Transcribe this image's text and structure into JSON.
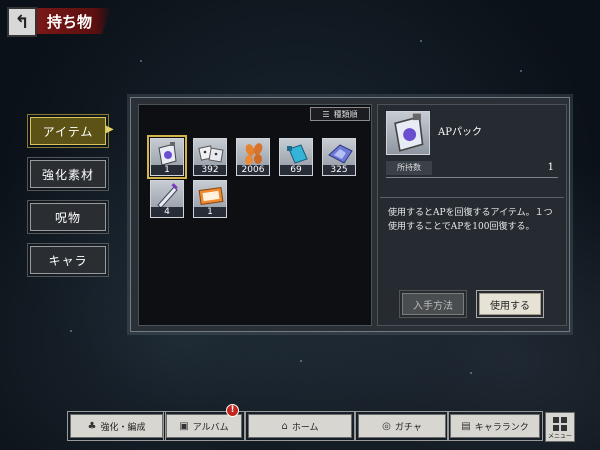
{
  "header": {
    "back_icon": "back-arrow-icon",
    "title": "持ち物"
  },
  "tabs": [
    {
      "label": "アイテム",
      "active": true
    },
    {
      "label": "強化素材",
      "active": false
    },
    {
      "label": "呪物",
      "active": false
    },
    {
      "label": "キャラ",
      "active": false
    }
  ],
  "sort_label": "種類順",
  "items": [
    {
      "name": "AP pack",
      "icon": "ap-pack-icon",
      "count": "1",
      "selected": true
    },
    {
      "name": "dice",
      "icon": "dice-icon",
      "count": "392"
    },
    {
      "name": "seeds",
      "icon": "seeds-icon",
      "count": "2006"
    },
    {
      "name": "bottle",
      "icon": "bottle-icon",
      "count": "69"
    },
    {
      "name": "crystal",
      "icon": "crystal-icon",
      "count": "325"
    },
    {
      "name": "sword",
      "icon": "sword-icon",
      "count": "4"
    },
    {
      "name": "ticket",
      "icon": "ticket-icon",
      "count": "1"
    }
  ],
  "detail": {
    "name": "APパック",
    "qty_label": "所持数",
    "qty_value": "1",
    "description": "使用するとAPを回復するアイテム。１つ使用することでAPを100回復する。",
    "source_button": "入手方法",
    "use_button": "使用する"
  },
  "nav": {
    "enhance": "強化・編成",
    "album": "アルバム",
    "album_badge": "!",
    "home": "ホーム",
    "gacha": "ガチャ",
    "character_rank": "キャラランク",
    "menu": "メニュー"
  },
  "colors": {
    "title_red": "#7a1818",
    "active_tab_gold": "#d8c45a",
    "selected_outline": "#d3b54c",
    "badge_red": "#c4261d"
  }
}
